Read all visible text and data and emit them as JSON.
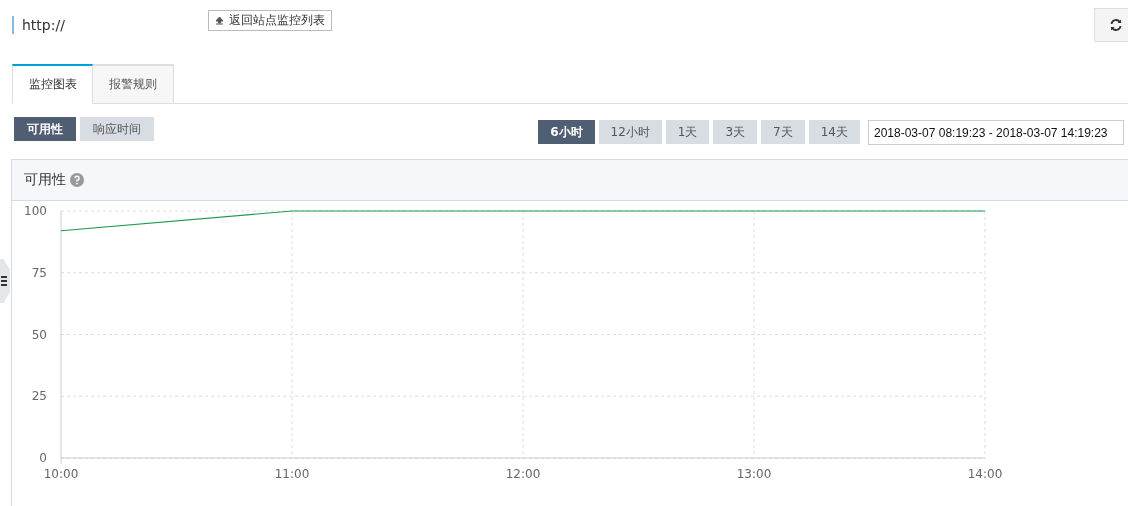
{
  "header": {
    "url": "http://",
    "back_button": "返回站点监控列表"
  },
  "tabs": [
    {
      "label": "监控图表",
      "selected": true
    },
    {
      "label": "报警规则",
      "selected": false
    }
  ],
  "metric_buttons": [
    {
      "label": "可用性",
      "selected": true
    },
    {
      "label": "响应时间",
      "selected": false
    }
  ],
  "range_buttons": [
    {
      "label": "6小时",
      "selected": true
    },
    {
      "label": "12小时",
      "selected": false
    },
    {
      "label": "1天",
      "selected": false
    },
    {
      "label": "3天",
      "selected": false
    },
    {
      "label": "7天",
      "selected": false
    },
    {
      "label": "14天",
      "selected": false
    }
  ],
  "date_range": {
    "value": "2018-03-07 08:19:23 - 2018-03-07 14:19:23"
  },
  "panel": {
    "title": "可用性",
    "chart_data": {
      "type": "line",
      "categories": [
        "10:00",
        "11:00",
        "12:00",
        "13:00",
        "14:00"
      ],
      "series": [
        {
          "color": "#1e9a4e",
          "values": [
            92,
            100,
            100,
            100,
            100
          ]
        }
      ],
      "grid": true,
      "ylim": [
        0,
        100
      ],
      "yticks": [
        0,
        25,
        50,
        75,
        100
      ]
    }
  }
}
